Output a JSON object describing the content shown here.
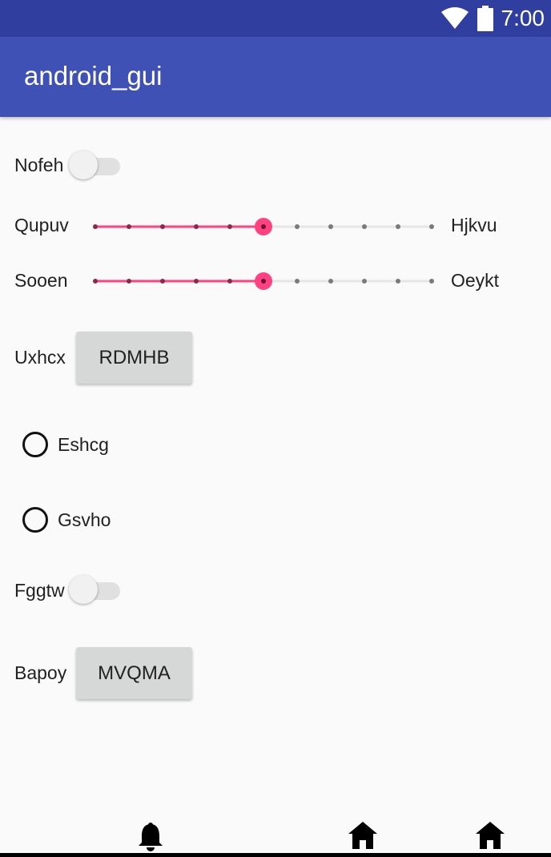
{
  "status_bar": {
    "time": "7:00",
    "icons": [
      "wifi-icon",
      "battery-icon"
    ]
  },
  "app_bar": {
    "title": "android_gui"
  },
  "colors": {
    "accent": "#ff4081",
    "primary": "#3f51b5",
    "primary_dark": "#303f9f"
  },
  "rows": {
    "switch1": {
      "label": "Nofeh",
      "checked": false
    },
    "slider1": {
      "label": "Qupuv",
      "end_label": "Hjkvu",
      "value": 5,
      "max": 10
    },
    "slider2": {
      "label": "Sooen",
      "end_label": "Oeykt",
      "value": 5,
      "max": 10
    },
    "button1": {
      "label": "Uxhcx",
      "button_text": "RDMHB"
    },
    "radio1": {
      "label": "Eshcg",
      "checked": false
    },
    "radio2": {
      "label": "Gsvho",
      "checked": false
    },
    "switch2": {
      "label": "Fggtw",
      "checked": false
    },
    "button2": {
      "label": "Bapoy",
      "button_text": "MVQMA"
    }
  },
  "bottom_nav": {
    "icons": [
      "bell-icon",
      "home-icon",
      "home-icon"
    ]
  }
}
